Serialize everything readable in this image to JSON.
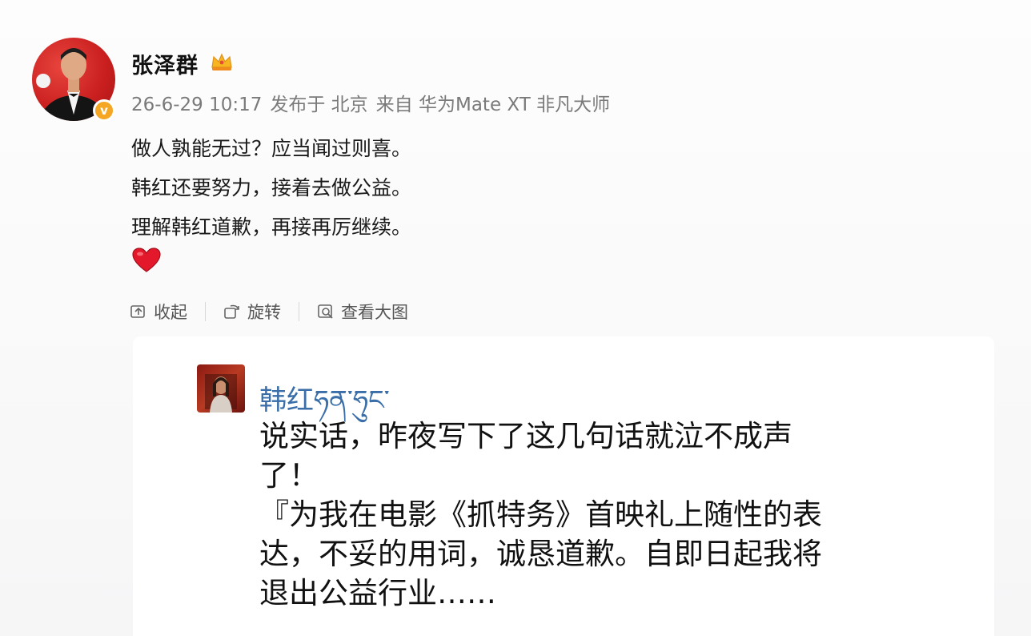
{
  "post": {
    "username": "张泽群",
    "meta": {
      "time": "26-6-29 10:17",
      "location": "发布于 北京",
      "source": "来自 华为Mate XT 非凡大师"
    },
    "lines": [
      "做人孰能无过？应当闻过则喜。",
      "韩红还要努力，接着去做公益。",
      "理解韩红道歉，再接再厉继续。"
    ],
    "verified_icon": "verified-badge-icon",
    "crown_icon": "crown-icon",
    "emoji_icon": "red-heart-icon"
  },
  "actions": {
    "collapse_label": "收起",
    "rotate_label": "旋转",
    "view_large_label": "查看大图"
  },
  "embedded": {
    "name": "韩红ཧན་ཧུང་",
    "text_lines": [
      "说实话，昨夜写下了这几句话就泣不成声",
      "了！",
      "『为我在电影《抓特务》首映礼上随性的表",
      "达，不妥的用词，诚恳道歉。自即日起我将",
      "退出公益行业……"
    ]
  },
  "colors": {
    "meta_gray": "#7a7a7a",
    "name_blue": "#3a6ea8",
    "verified_orange": "#f5a623",
    "avatar_red": "#c81e1e"
  }
}
